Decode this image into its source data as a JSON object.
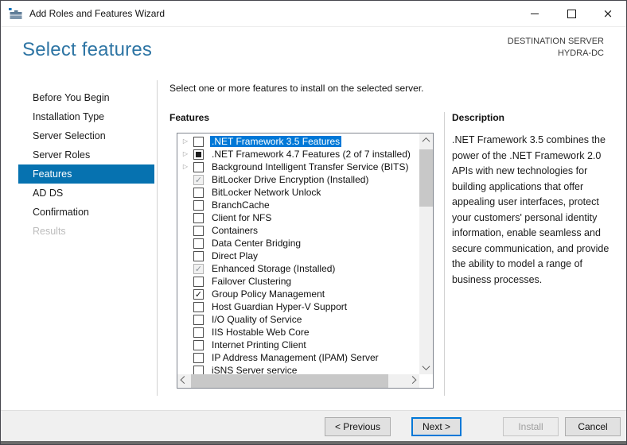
{
  "window": {
    "title": "Add Roles and Features Wizard"
  },
  "header": {
    "title": "Select features",
    "destination_label": "DESTINATION SERVER",
    "destination_server": "HYDRA-DC"
  },
  "sidebar": {
    "items": [
      {
        "label": "Before You Begin",
        "state": "normal"
      },
      {
        "label": "Installation Type",
        "state": "normal"
      },
      {
        "label": "Server Selection",
        "state": "normal"
      },
      {
        "label": "Server Roles",
        "state": "normal"
      },
      {
        "label": "Features",
        "state": "selected"
      },
      {
        "label": "AD DS",
        "state": "normal"
      },
      {
        "label": "Confirmation",
        "state": "normal"
      },
      {
        "label": "Results",
        "state": "disabled"
      }
    ]
  },
  "main": {
    "instruction": "Select one or more features to install on the selected server.",
    "features_label": "Features",
    "features": [
      {
        "label": ".NET Framework 3.5 Features",
        "checkbox": "unchecked",
        "expander": true,
        "selected": true
      },
      {
        "label": ".NET Framework 4.7 Features (2 of 7 installed)",
        "checkbox": "indeterminate",
        "expander": true,
        "selected": false
      },
      {
        "label": "Background Intelligent Transfer Service (BITS)",
        "checkbox": "unchecked",
        "expander": true,
        "selected": false
      },
      {
        "label": "BitLocker Drive Encryption (Installed)",
        "checkbox": "checked-disabled",
        "expander": false,
        "selected": false
      },
      {
        "label": "BitLocker Network Unlock",
        "checkbox": "unchecked",
        "expander": false,
        "selected": false
      },
      {
        "label": "BranchCache",
        "checkbox": "unchecked",
        "expander": false,
        "selected": false
      },
      {
        "label": "Client for NFS",
        "checkbox": "unchecked",
        "expander": false,
        "selected": false
      },
      {
        "label": "Containers",
        "checkbox": "unchecked",
        "expander": false,
        "selected": false
      },
      {
        "label": "Data Center Bridging",
        "checkbox": "unchecked",
        "expander": false,
        "selected": false
      },
      {
        "label": "Direct Play",
        "checkbox": "unchecked",
        "expander": false,
        "selected": false
      },
      {
        "label": "Enhanced Storage (Installed)",
        "checkbox": "checked-disabled",
        "expander": false,
        "selected": false
      },
      {
        "label": "Failover Clustering",
        "checkbox": "unchecked",
        "expander": false,
        "selected": false
      },
      {
        "label": "Group Policy Management",
        "checkbox": "checked",
        "expander": false,
        "selected": false
      },
      {
        "label": "Host Guardian Hyper-V Support",
        "checkbox": "unchecked",
        "expander": false,
        "selected": false
      },
      {
        "label": "I/O Quality of Service",
        "checkbox": "unchecked",
        "expander": false,
        "selected": false
      },
      {
        "label": "IIS Hostable Web Core",
        "checkbox": "unchecked",
        "expander": false,
        "selected": false
      },
      {
        "label": "Internet Printing Client",
        "checkbox": "unchecked",
        "expander": false,
        "selected": false
      },
      {
        "label": "IP Address Management (IPAM) Server",
        "checkbox": "unchecked",
        "expander": false,
        "selected": false
      },
      {
        "label": "iSNS Server service",
        "checkbox": "unchecked",
        "expander": false,
        "selected": false
      }
    ]
  },
  "description": {
    "heading": "Description",
    "text": ".NET Framework 3.5 combines the power of the .NET Framework 2.0 APIs with new technologies for building applications that offer appealing user interfaces, protect your customers' personal identity information, enable seamless and secure communication, and provide the ability to model a range of business processes."
  },
  "footer": {
    "buttons": [
      {
        "label": "< Previous",
        "state": "normal"
      },
      {
        "label": "Next >",
        "state": "default"
      },
      {
        "label": "Install",
        "state": "disabled"
      },
      {
        "label": "Cancel",
        "state": "normal"
      }
    ]
  },
  "colors": {
    "accent_selection": "#0078d7",
    "sidebar_selected": "#0672b0",
    "header_title": "#2e75a4",
    "footer_background": "#f0f0f0"
  }
}
